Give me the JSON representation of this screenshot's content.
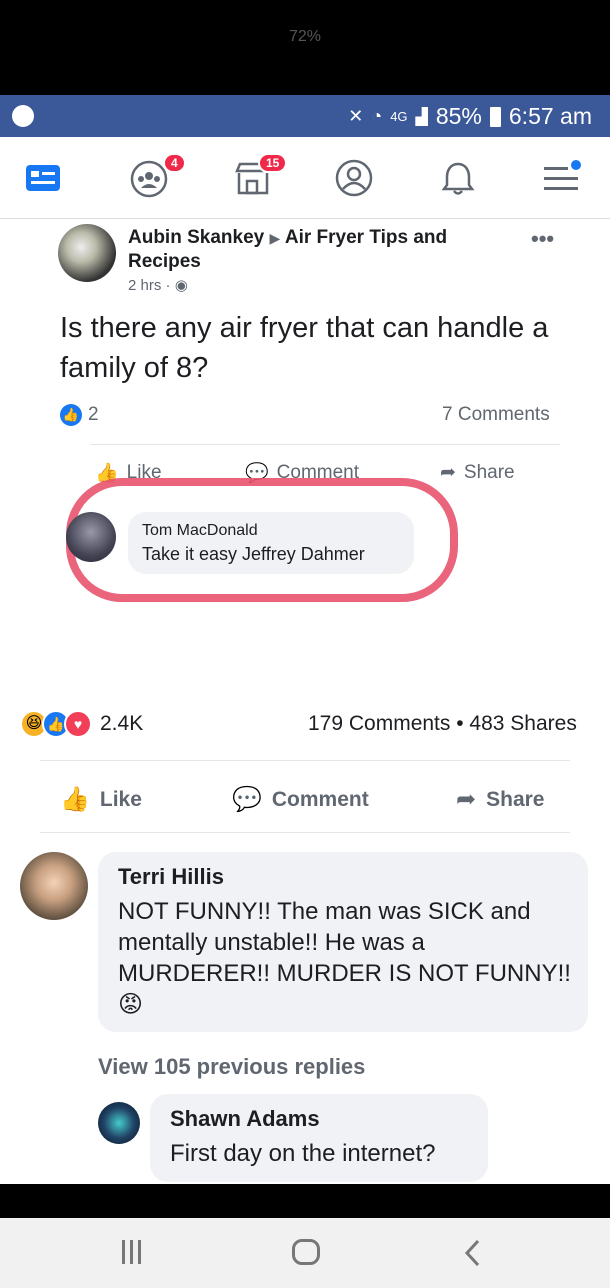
{
  "system": {
    "outer_battery": "72%",
    "network": "4G",
    "battery": "85%",
    "time": "6:57 am"
  },
  "nav": {
    "groups_badge": "4",
    "marketplace_badge": "15"
  },
  "post": {
    "author": "Aubin Skankey",
    "group": "Air Fryer Tips and Recipes",
    "time": "2 hrs",
    "text": "Is there any air fryer that can handle a family of 8?",
    "reactions": "2",
    "comments": "7 Comments",
    "like": "Like",
    "comment": "Comment",
    "share": "Share",
    "reply": {
      "name": "Tom MacDonald",
      "text": "Take it easy Jeffrey Dahmer"
    }
  },
  "outer": {
    "reactions": "2.4K",
    "counts": "179 Comments • 483 Shares",
    "like": "Like",
    "comment": "Comment",
    "share": "Share",
    "comment1": {
      "name": "Terri Hillis",
      "text": "NOT FUNNY!! The man was SICK and mentally unstable!! He was a MURDERER!! MURDER IS NOT FUNNY!!"
    },
    "view_replies": "View 105 previous replies",
    "comment2": {
      "name": "Shawn Adams",
      "text": "First day on the internet?"
    }
  }
}
